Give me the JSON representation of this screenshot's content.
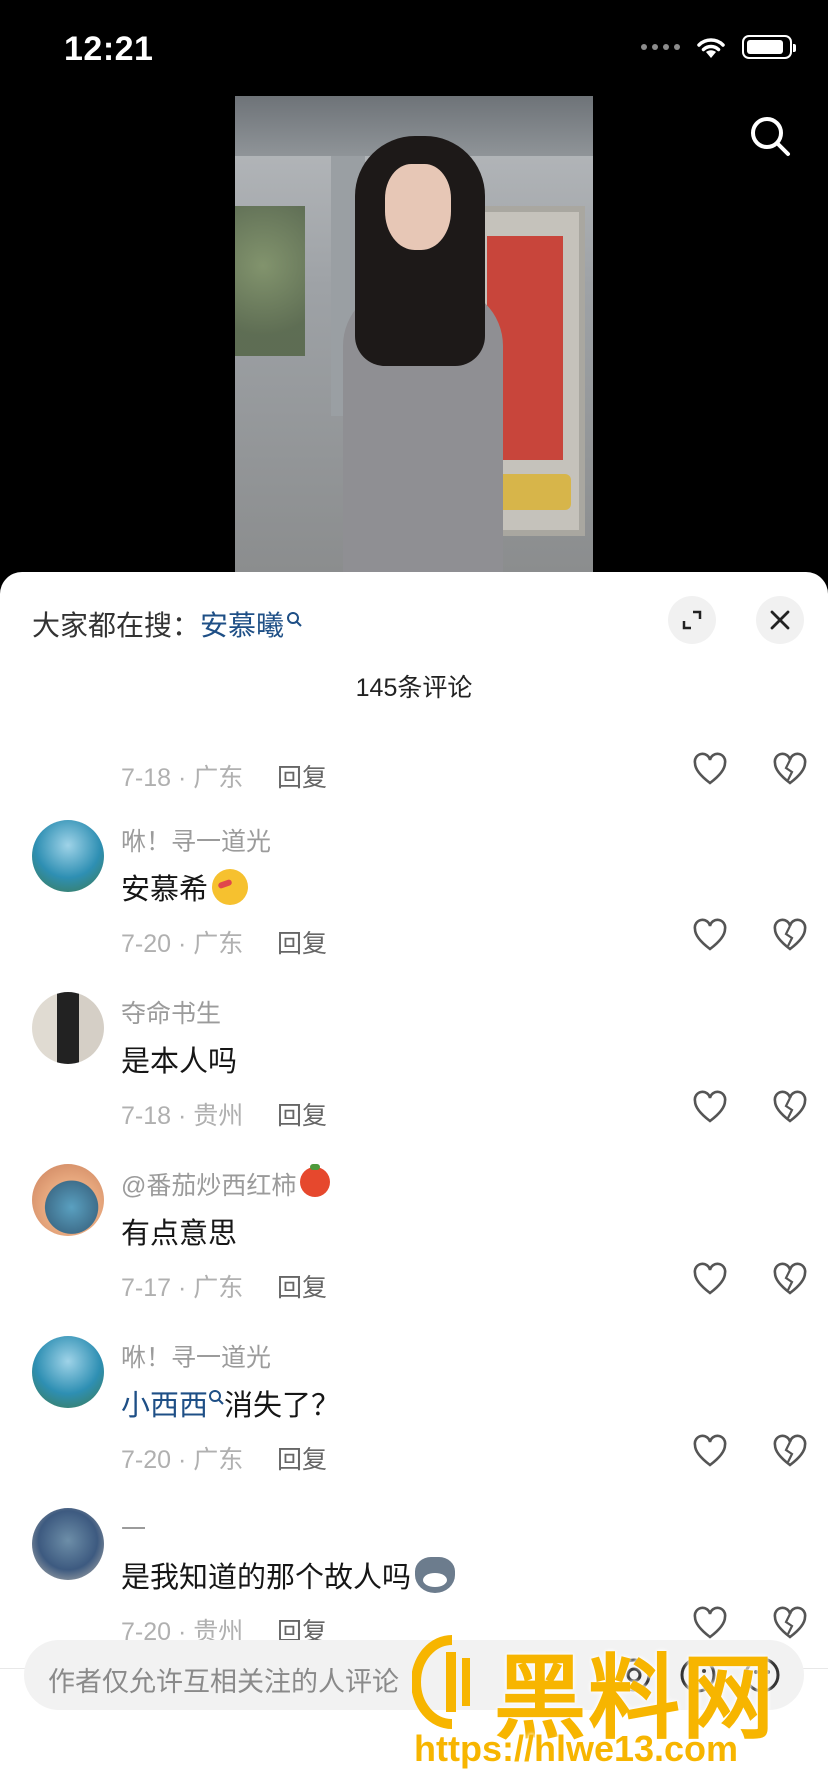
{
  "status_bar": {
    "time": "12:21"
  },
  "sheet": {
    "hot_search_prefix": "大家都在搜：",
    "hot_search_term": "安慕曦",
    "comment_count": "145条评论"
  },
  "comments": [
    {
      "username": "",
      "text": "",
      "date_location": "7-18 · 广东",
      "reply": "回复",
      "avatar_colors": [
        "#ffffff",
        "#ffffff"
      ]
    },
    {
      "username": "咻！寻一道光",
      "text": "安慕希",
      "date_location": "7-20 · 广东",
      "reply": "回复",
      "avatar_colors": [
        "#2e8fb3",
        "#5bb47a"
      ]
    },
    {
      "username": "夺命书生",
      "text": "是本人吗",
      "date_location": "7-18 · 贵州",
      "reply": "回复",
      "avatar_colors": [
        "#d9d4cc",
        "#2a2a2a"
      ]
    },
    {
      "username": "@番茄炒西红柿",
      "text": "有点意思",
      "date_location": "7-17 · 广东",
      "reply": "回复",
      "avatar_colors": [
        "#e5a57f",
        "#5a8fb0"
      ]
    },
    {
      "username": "咻！寻一道光",
      "text_link": "小西西",
      "text": "消失了？",
      "date_location": "7-20 · 广东",
      "reply": "回复",
      "avatar_colors": [
        "#2e8fb3",
        "#5bb47a"
      ]
    },
    {
      "username": "一",
      "text": "是我知道的那个故人吗",
      "date_location": "7-20 · 贵州",
      "reply": "回复",
      "avatar_colors": [
        "#7a8e96",
        "#3d5a80"
      ]
    }
  ],
  "input": {
    "placeholder": "作者仅允许互相关注的人评论"
  },
  "watermark": {
    "title": "黑料网",
    "url": "https://hlwe13.com"
  },
  "icons": [
    "search-icon",
    "expand-icon",
    "close-icon",
    "heart-icon",
    "dislike-icon",
    "mention-icon",
    "emoji-icon"
  ],
  "colors": {
    "link": "#1e4f86",
    "watermark": "#f7b500"
  }
}
